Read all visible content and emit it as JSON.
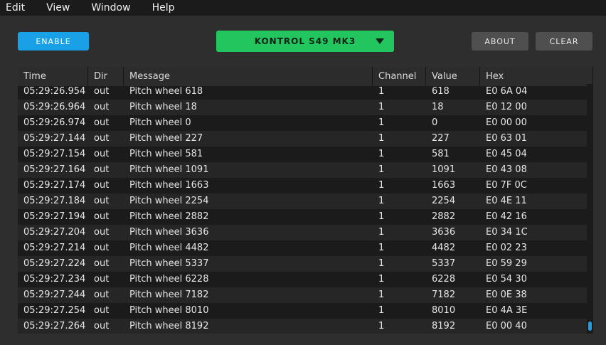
{
  "menu": [
    "Edit",
    "View",
    "Window",
    "Help"
  ],
  "toolbar": {
    "enable_label": "ENABLE",
    "device_label": "KONTROL S49 MK3",
    "about_label": "ABOUT",
    "clear_label": "CLEAR"
  },
  "colors": {
    "enable": "#1aa0e6",
    "device": "#22c55e",
    "button": "#4f4f4f"
  },
  "table": {
    "columns": [
      "Time",
      "Dir",
      "Message",
      "Channel",
      "Value",
      "Hex"
    ],
    "rows": [
      [
        "05:29:26.954",
        "out",
        "Pitch wheel 618",
        "1",
        "618",
        "E0 6A 04"
      ],
      [
        "05:29:26.964",
        "out",
        "Pitch wheel 18",
        "1",
        "18",
        "E0 12 00"
      ],
      [
        "05:29:26.974",
        "out",
        "Pitch wheel 0",
        "1",
        "0",
        "E0 00 00"
      ],
      [
        "05:29:27.144",
        "out",
        "Pitch wheel 227",
        "1",
        "227",
        "E0 63 01"
      ],
      [
        "05:29:27.154",
        "out",
        "Pitch wheel 581",
        "1",
        "581",
        "E0 45 04"
      ],
      [
        "05:29:27.164",
        "out",
        "Pitch wheel 1091",
        "1",
        "1091",
        "E0 43 08"
      ],
      [
        "05:29:27.174",
        "out",
        "Pitch wheel 1663",
        "1",
        "1663",
        "E0 7F 0C"
      ],
      [
        "05:29:27.184",
        "out",
        "Pitch wheel 2254",
        "1",
        "2254",
        "E0 4E 11"
      ],
      [
        "05:29:27.194",
        "out",
        "Pitch wheel 2882",
        "1",
        "2882",
        "E0 42 16"
      ],
      [
        "05:29:27.204",
        "out",
        "Pitch wheel 3636",
        "1",
        "3636",
        "E0 34 1C"
      ],
      [
        "05:29:27.214",
        "out",
        "Pitch wheel 4482",
        "1",
        "4482",
        "E0 02 23"
      ],
      [
        "05:29:27.224",
        "out",
        "Pitch wheel 5337",
        "1",
        "5337",
        "E0 59 29"
      ],
      [
        "05:29:27.234",
        "out",
        "Pitch wheel 6228",
        "1",
        "6228",
        "E0 54 30"
      ],
      [
        "05:29:27.244",
        "out",
        "Pitch wheel 7182",
        "1",
        "7182",
        "E0 0E 38"
      ],
      [
        "05:29:27.254",
        "out",
        "Pitch wheel 8010",
        "1",
        "8010",
        "E0 4A 3E"
      ],
      [
        "05:29:27.264",
        "out",
        "Pitch wheel 8192",
        "1",
        "8192",
        "E0 00 40"
      ]
    ]
  }
}
